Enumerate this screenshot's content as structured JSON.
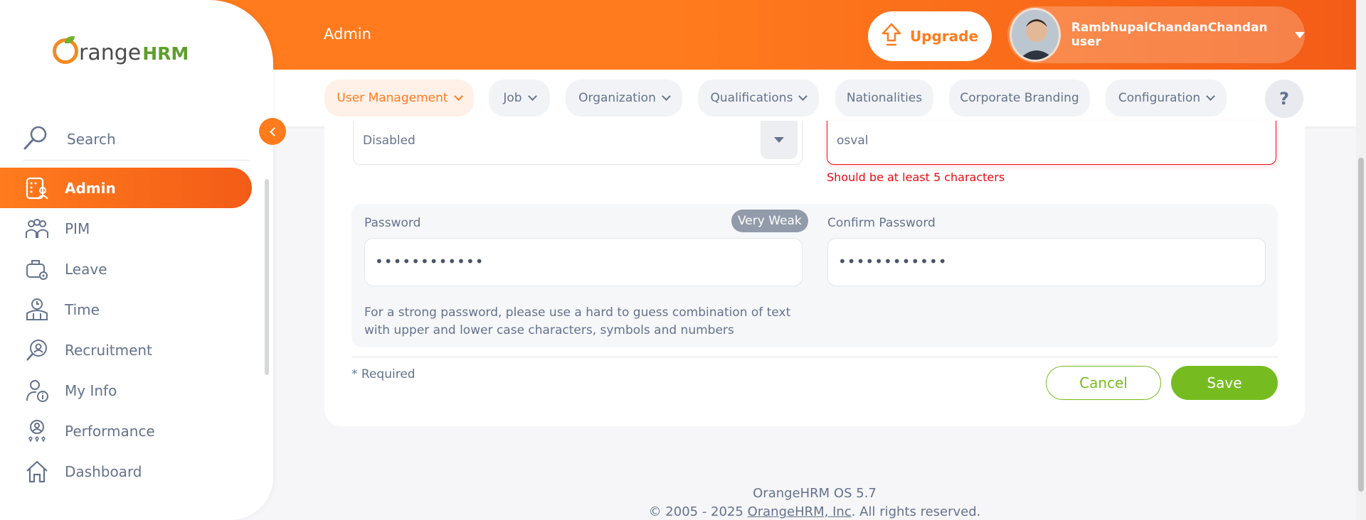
{
  "header": {
    "title": "Admin",
    "upgrade_label": "Upgrade",
    "user_name": "RambhupalChandanChandan user"
  },
  "nav": {
    "items": [
      {
        "label": "User Management",
        "dropdown": true,
        "active": true
      },
      {
        "label": "Job",
        "dropdown": true
      },
      {
        "label": "Organization",
        "dropdown": true
      },
      {
        "label": "Qualifications",
        "dropdown": true
      },
      {
        "label": "Nationalities",
        "dropdown": false
      },
      {
        "label": "Corporate Branding",
        "dropdown": false
      },
      {
        "label": "Configuration",
        "dropdown": true
      }
    ],
    "help_label": "?"
  },
  "sidebar": {
    "logo_text_1": "range",
    "logo_text_2": "HRM",
    "search_label": "Search",
    "items": [
      {
        "label": "Admin",
        "icon": "admin-icon",
        "active": true
      },
      {
        "label": "PIM",
        "icon": "pim-icon"
      },
      {
        "label": "Leave",
        "icon": "leave-icon"
      },
      {
        "label": "Time",
        "icon": "time-icon"
      },
      {
        "label": "Recruitment",
        "icon": "recruitment-icon"
      },
      {
        "label": "My Info",
        "icon": "my-info-icon"
      },
      {
        "label": "Performance",
        "icon": "performance-icon"
      },
      {
        "label": "Dashboard",
        "icon": "dashboard-icon"
      }
    ]
  },
  "form": {
    "status_value": "Disabled",
    "username_value": "osval",
    "username_error": "Should be at least 5 characters",
    "password_label": "Password",
    "password_strength": "Very Weak",
    "password_value": "••••••••••••",
    "confirm_label": "Confirm Password",
    "confirm_value": "••••••••••••",
    "hint": "For a strong password, please use a hard to guess combination of text with upper and lower case characters, symbols and numbers",
    "required_note": "* Required",
    "cancel_label": "Cancel",
    "save_label": "Save"
  },
  "footer": {
    "version": "OrangeHRM OS 5.7",
    "copyright_prefix": "© 2005 - 2025 ",
    "company_link": "OrangeHRM, Inc",
    "copyright_suffix": ". All rights reserved."
  },
  "colors": {
    "brand_orange": "#ff7b1d",
    "save_green": "#76bc21",
    "error_red": "#eb0910"
  }
}
